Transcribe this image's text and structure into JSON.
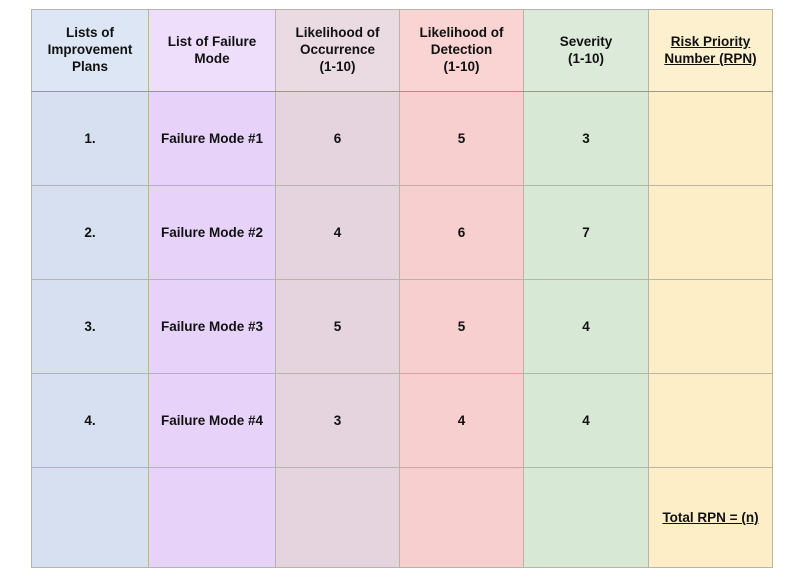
{
  "table": {
    "headers": [
      {
        "key": "plans",
        "lines": [
          "Lists of",
          "Improvement",
          "Plans"
        ],
        "underline": false
      },
      {
        "key": "mode",
        "lines": [
          "List of Failure",
          "Mode"
        ],
        "underline": false
      },
      {
        "key": "occurrence",
        "lines": [
          "Likelihood of",
          "Occurrence",
          "(1-10)"
        ],
        "underline": false
      },
      {
        "key": "detection",
        "lines": [
          "Likelihood of",
          "Detection",
          "(1-10)"
        ],
        "underline": false
      },
      {
        "key": "severity",
        "lines": [
          "Severity",
          "(1-10)"
        ],
        "underline": false
      },
      {
        "key": "rpn",
        "lines": [
          "Risk Priority",
          "Number (RPN)"
        ],
        "underline": true
      }
    ],
    "header_text": {
      "plans_line1": "Lists of",
      "plans_line2": "Improvement",
      "plans_line3": "Plans",
      "mode_line1": "List of Failure",
      "mode_line2": "Mode",
      "occurrence_line1": "Likelihood of",
      "occurrence_line2": "Occurrence",
      "occurrence_line3": "(1-10)",
      "detection_line1": "Likelihood of",
      "detection_line2": "Detection",
      "detection_line3": "(1-10)",
      "severity_line1": "Severity",
      "severity_line2": "(1-10)",
      "rpn_line1": "Risk Priority",
      "rpn_line2": "Number (RPN)"
    },
    "rows": [
      {
        "index": "1.",
        "failure_mode": "Failure Mode #1",
        "occurrence": "6",
        "detection": "5",
        "severity": "3",
        "rpn": ""
      },
      {
        "index": "2.",
        "failure_mode": "Failure Mode #2",
        "occurrence": "4",
        "detection": "6",
        "severity": "7",
        "rpn": ""
      },
      {
        "index": "3.",
        "failure_mode": "Failure Mode #3",
        "occurrence": "5",
        "detection": "5",
        "severity": "4",
        "rpn": ""
      },
      {
        "index": "4.",
        "failure_mode": "Failure Mode #4",
        "occurrence": "3",
        "detection": "4",
        "severity": "4",
        "rpn": ""
      }
    ],
    "total_row": {
      "index": "",
      "failure_mode": "",
      "occurrence": "",
      "detection": "",
      "severity": "",
      "rpn": "Total RPN = (n)"
    },
    "colors": {
      "plans": "#d6e0f0",
      "mode": "#e7d3f9",
      "occurrence": "#e5d3dd",
      "detection": "#f8cfcf",
      "severity": "#d7e8d4",
      "rpn": "#fdeec8",
      "plans_header": "#dde6f4",
      "mode_header": "#eeddfb",
      "occurrence_header": "#eadbe3",
      "detection_header": "#f9d4d2",
      "severity_header": "#dcebd9",
      "rpn_header": "#fdf0ce",
      "border": "#b6b6a8",
      "outer_border": "#9a9a86",
      "text": "#111111",
      "page_background": "#ffffff"
    }
  }
}
